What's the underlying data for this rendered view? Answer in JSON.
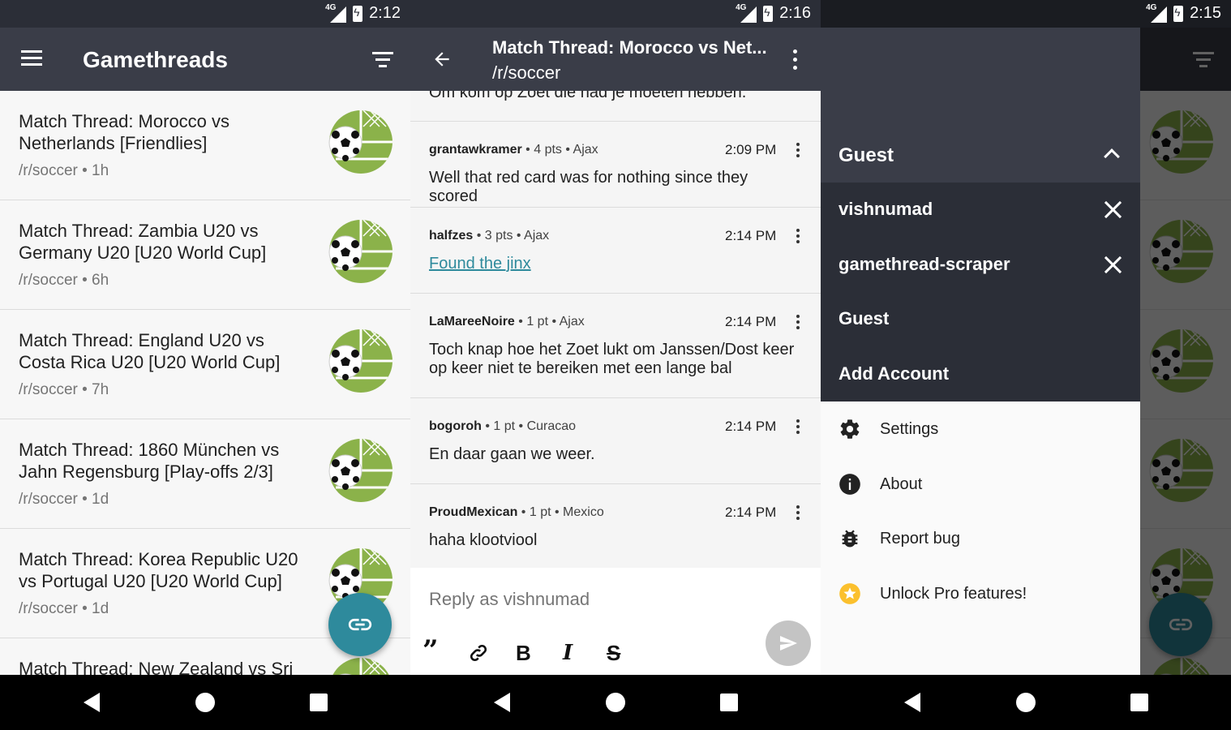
{
  "panel1": {
    "status": {
      "network": "4G",
      "time": "2:12"
    },
    "toolbar": {
      "title": "Gamethreads"
    },
    "threads": [
      {
        "title": "Match Thread: Morocco vs Netherlands [Friendlies]",
        "meta": "/r/soccer • 1h"
      },
      {
        "title": "Match Thread: Zambia U20 vs Germany U20 [U20 World Cup]",
        "meta": "/r/soccer • 6h"
      },
      {
        "title": "Match Thread: England U20 vs Costa Rica U20 [U20 World Cup]",
        "meta": "/r/soccer • 7h"
      },
      {
        "title": "Match Thread: 1860 München vs Jahn Regensburg [Play-offs 2/3]",
        "meta": "/r/soccer • 1d"
      },
      {
        "title": "Match Thread: Korea Republic U20 vs Portugal U20 [U20 World Cup]",
        "meta": "/r/soccer • 1d"
      },
      {
        "title": "Match Thread: New Zealand vs Sri",
        "meta": ""
      }
    ]
  },
  "panel2": {
    "status": {
      "network": "4G",
      "time": "2:16"
    },
    "toolbar": {
      "title": "Match Thread: Morocco vs Net...",
      "subtitle": "/r/soccer"
    },
    "cut_text": "Om kom op Zoet die had je moeten hebben.",
    "comments": [
      {
        "user": "grantawkramer",
        "points": "4 pts",
        "flair": "Ajax",
        "time": "2:09 PM",
        "body": "Well that red card was for nothing since they scored",
        "link": false
      },
      {
        "user": "halfzes",
        "points": "3 pts",
        "flair": "Ajax",
        "time": "2:14 PM",
        "body": "Found the jinx",
        "link": true
      },
      {
        "user": "LaMareeNoire",
        "points": "1 pt",
        "flair": "Ajax",
        "time": "2:14 PM",
        "body": "Toch knap hoe het Zoet lukt om Janssen/Dost keer op keer niet te bereiken met een lange bal",
        "link": false
      },
      {
        "user": "bogoroh",
        "points": "1 pt",
        "flair": "Curacao",
        "time": "2:14 PM",
        "body": "En daar gaan we weer.",
        "link": false
      },
      {
        "user": "ProudMexican",
        "points": "1 pt",
        "flair": "Mexico",
        "time": "2:14 PM",
        "body": "haha klootviool",
        "link": false
      }
    ],
    "reply": {
      "placeholder": "Reply as vishnumad"
    }
  },
  "panel3": {
    "status": {
      "network": "4G",
      "time": "2:15"
    },
    "drawer": {
      "current_account": "Guest",
      "accounts": [
        {
          "name": "vishnumad",
          "removable": true
        },
        {
          "name": "gamethread-scraper",
          "removable": true
        },
        {
          "name": "Guest",
          "removable": false
        },
        {
          "name": "Add Account",
          "removable": false
        }
      ],
      "menu": [
        {
          "label": "Settings",
          "icon": "gear-icon"
        },
        {
          "label": "About",
          "icon": "info-icon"
        },
        {
          "label": "Report bug",
          "icon": "bug-icon"
        },
        {
          "label": "Unlock Pro features!",
          "icon": "star-icon"
        }
      ]
    }
  },
  "colors": {
    "toolbar": "#3a3d48",
    "statusbar": "#2b2e37",
    "accent": "#2e8a9c",
    "logo_green": "#8bb24a",
    "star_yellow": "#fbc02d"
  }
}
